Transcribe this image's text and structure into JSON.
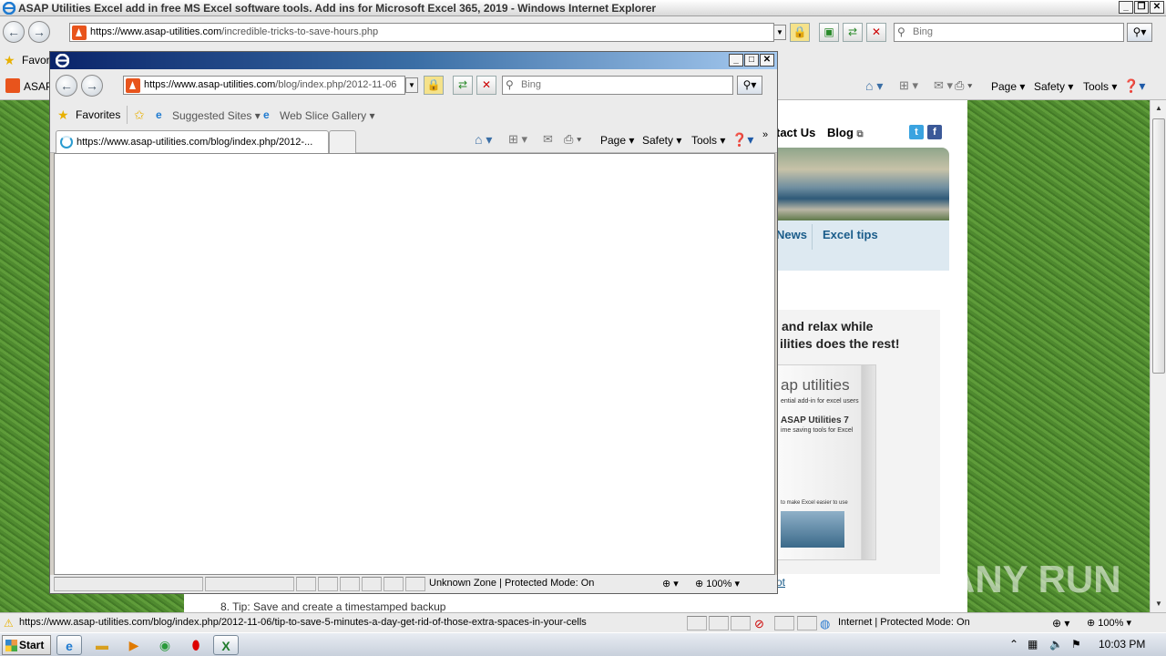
{
  "outer_window": {
    "title": "ASAP Utilities Excel add in free MS Excel software tools. Add ins for Microsoft Excel 365, 2019 - Windows Internet Explorer",
    "url_host": "https://www.asap-utilities.com",
    "url_path": "/incredible-tricks-to-save-hours.php",
    "search_placeholder": "Bing",
    "favorites_label": "Favori",
    "tab_label": "ASAP",
    "toolbar": {
      "page": "Page",
      "safety": "Safety",
      "tools": "Tools"
    },
    "status": {
      "url": "https://www.asap-utilities.com/blog/index.php/2012-11-06/tip-to-save-5-minutes-a-day-get-rid-of-those-extra-spaces-in-your-cells",
      "zone": "Internet | Protected Mode: On",
      "zoom": "100%"
    }
  },
  "web_page": {
    "nav_contact": "tact Us",
    "nav_blog": "Blog",
    "nav_news": "News",
    "nav_excel_tips": "Excel tips",
    "promo_line1": "and relax while",
    "promo_line2": "ilities does the rest!",
    "product_title": "ap utilities",
    "product_sub": "ential add-in for excel users",
    "product_name": "ASAP Utilities 7",
    "product_desc": "ime saving tools for Excel",
    "product_footer": "to make Excel easier to use",
    "link_ot": "ot",
    "list_item": "8.  Tip: Save and create a timestamped backup"
  },
  "popup_window": {
    "url_host": "https://www.asap-utilities.com",
    "url_path": "/blog/index.php/2012-11-06",
    "search_placeholder": "Bing",
    "favorites_label": "Favorites",
    "suggested_sites": "Suggested Sites",
    "web_slice_gallery": "Web Slice Gallery",
    "tab_label": "https://www.asap-utilities.com/blog/index.php/2012-...",
    "toolbar": {
      "page": "Page",
      "safety": "Safety",
      "tools": "Tools"
    },
    "status": {
      "zone": "Unknown Zone | Protected Mode: On",
      "zoom": "100%"
    }
  },
  "taskbar": {
    "start_label": "Start",
    "clock": "10:03 PM",
    "apps": [
      "internet-explorer-icon",
      "explorer-folder-icon",
      "media-player-icon",
      "chrome-icon",
      "opera-icon",
      "excel-icon"
    ]
  },
  "watermark": "ANY RUN",
  "colors": {
    "title_bar_dark": "#0a246a",
    "link_blue": "#1a5c8a",
    "brand_orange": "#e8541c"
  }
}
